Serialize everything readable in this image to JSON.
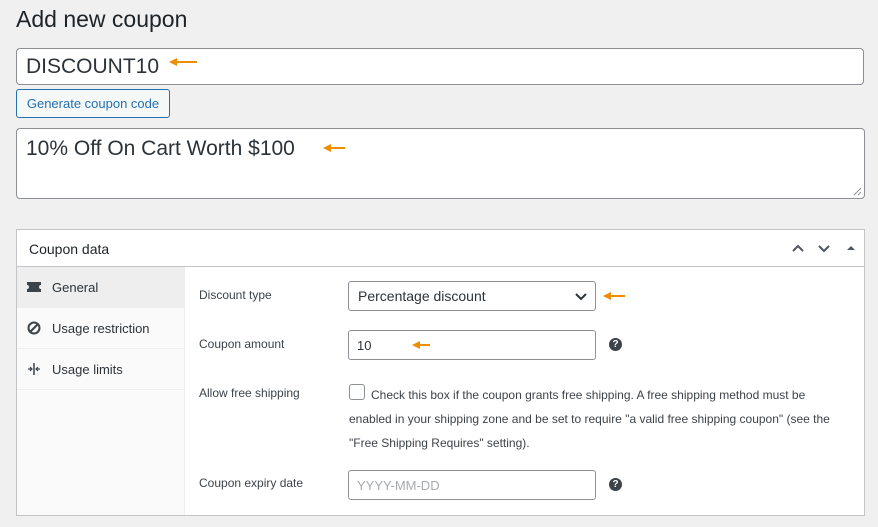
{
  "page": {
    "title": "Add new coupon"
  },
  "coupon": {
    "code_value": "DISCOUNT10",
    "generate_label": "Generate coupon code",
    "description_value": "10% Off On Cart Worth $100"
  },
  "coupon_data": {
    "title": "Coupon data",
    "tabs": [
      {
        "label": "General",
        "icon": "ticket-icon"
      },
      {
        "label": "Usage restriction",
        "icon": "ban-icon"
      },
      {
        "label": "Usage limits",
        "icon": "limits-icon"
      }
    ],
    "general": {
      "discount_type_label": "Discount type",
      "discount_type_value": "Percentage discount",
      "amount_label": "Coupon amount",
      "amount_value": "10",
      "free_shipping_label": "Allow free shipping",
      "free_shipping_desc": "Check this box if the coupon grants free shipping. A free shipping method must be enabled in your shipping zone and be set to require \"a valid free shipping coupon\" (see the \"Free Shipping Requires\" setting).",
      "expiry_label": "Coupon expiry date",
      "expiry_placeholder": "YYYY-MM-DD",
      "help_glyph": "?"
    }
  },
  "colors": {
    "accent": "#2271b1",
    "annotation_arrow": "#f08c00"
  }
}
